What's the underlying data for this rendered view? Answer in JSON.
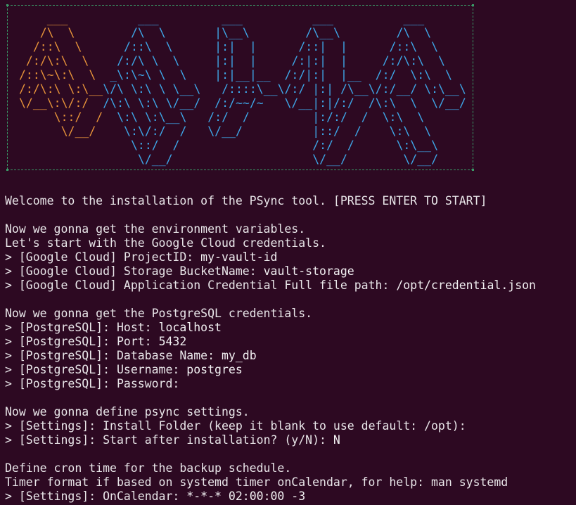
{
  "window": {
    "background": "#2d0922",
    "text_color": "#e9e6e9"
  },
  "banner": {
    "art_lines": [
      "    ___          ___         ___          ___          ___",
      "   /\\  \\        /\\  \\       |\\__\\        /\\__\\        /\\  \\",
      "  /::\\  \\      /::\\  \\      |:|  |      /::|  |      /::\\  \\",
      " /:/\\:\\  \\    /:/\\ \\  \\     |:|  |     /:|:|  |     /:/\\:\\  \\",
      "/::\\~\\:\\  \\  _\\:\\~\\ \\  \\    |:|__|__  /:/|:|  |__  /:/  \\:\\  \\",
      "/:/\\:\\ \\:\\__\\/\\ \\:\\ \\ \\__\\   /::::\\__\\/:/ |:| /\\__\\/:/__/ \\:\\__\\",
      "\\/__\\:\\/:/  /\\:\\ \\:\\ \\/__/  /:/~~/~   \\/__|:|/:/  /\\:\\  \\  \\/__/",
      "     \\::/  /  \\:\\ \\:\\__\\   /:/  /         |:/:/  /  \\:\\  \\",
      "      \\/__/    \\:\\/:/  /   \\/__/          |::/  /    \\:\\  \\",
      "                \\::/  /                   /:/  /      \\:\\__\\",
      "                 \\/__/                    \\/__/        \\/__/"
    ],
    "letter_colors": [
      "#e8943a",
      "#3ea7e8",
      "#3ea7e8",
      "#3ea7e8",
      "#3ea7e8"
    ],
    "frame_color": "#3a9a67"
  },
  "console": {
    "welcome": "Welcome to the installation of the PSync tool. [PRESS ENTER TO START]",
    "env_intro": "Now we gonna get the environment variables.",
    "gcloud_intro": "Let's start with the Google Cloud credentials.",
    "gcloud": [
      {
        "prompt": "> ",
        "section": "[Google Cloud]",
        "field": " ProjectID: ",
        "value": "my-vault-id"
      },
      {
        "prompt": "> ",
        "section": "[Google Cloud]",
        "field": " Storage BucketName: ",
        "value": "vault-storage"
      },
      {
        "prompt": "> ",
        "section": "[Google Cloud]",
        "field": " Application Credential Full file path: ",
        "value": "/opt/credential.json"
      }
    ],
    "pg_intro": "Now we gonna get the PostgreSQL credentials.",
    "pg": [
      {
        "prompt": "> ",
        "section": "[PostgreSQL]:",
        "field": " Host: ",
        "value": "localhost"
      },
      {
        "prompt": "> ",
        "section": "[PostgreSQL]:",
        "field": " Port: ",
        "value": "5432"
      },
      {
        "prompt": "> ",
        "section": "[PostgreSQL]:",
        "field": " Database Name: ",
        "value": "my_db"
      },
      {
        "prompt": "> ",
        "section": "[PostgreSQL]:",
        "field": " Username: ",
        "value": "postgres"
      },
      {
        "prompt": "> ",
        "section": "[PostgreSQL]:",
        "field": " Password: ",
        "value": ""
      }
    ],
    "settings_intro": "Now we gonna define psync settings.",
    "settings": [
      {
        "prompt": "> ",
        "section": "[Settings]:",
        "field": " Install Folder (keep it blank to use default: /opt): ",
        "value": ""
      },
      {
        "prompt": "> ",
        "section": "[Settings]:",
        "field": " Start after installation? (y/N): ",
        "value": "N"
      }
    ],
    "cron_intro": "Define cron time for the backup schedule.",
    "cron_help": "Timer format if based on systemd timer onCalendar, for help: man systemd",
    "cron": {
      "prompt": "> ",
      "section": "[Settings]:",
      "field": " OnCalendar: ",
      "value": "*-*-* 02:00:00 -3"
    }
  }
}
